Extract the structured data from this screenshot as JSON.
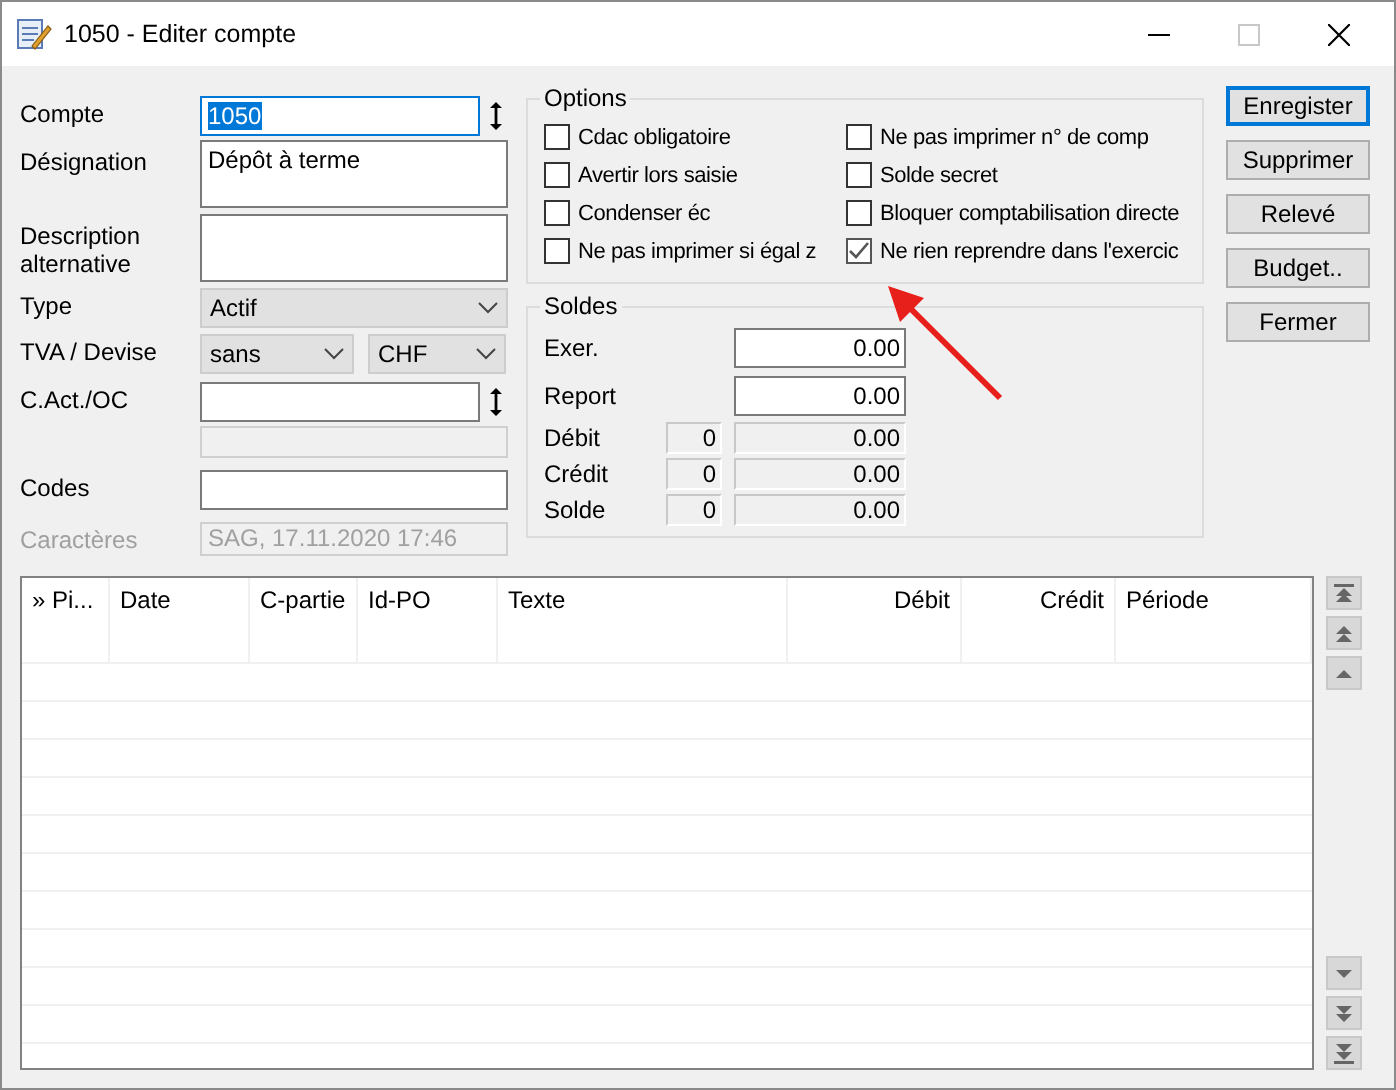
{
  "window": {
    "title": "1050 - Editer compte"
  },
  "fields": [
    {
      "kind": "spin",
      "label": "Compte",
      "value": "1050",
      "focused": true
    },
    {
      "kind": "memo",
      "label": "Désignation",
      "value": "Dépôt à terme",
      "focused": false
    },
    {
      "kind": "memo",
      "label": "Description alternative",
      "focused": false
    },
    {
      "kind": "combo",
      "label": "Type",
      "value": "Actif",
      "focused": false
    },
    {
      "kind": "combo-pair",
      "label": "TVA / Devise",
      "value": "sans",
      "value_2": "CHF",
      "focused": false
    },
    {
      "kind": "spin",
      "label": "C.Act./OC",
      "focused": false
    },
    {
      "kind": "blank",
      "focused": false
    },
    {
      "kind": "text",
      "label": "Codes",
      "focused": false
    },
    {
      "kind": "readonly",
      "label": "Caractères",
      "value": "SAG, 17.11.2020 17:46",
      "focused": false
    }
  ],
  "options": {
    "title": "Options",
    "items": [
      {
        "label": "Cdac obligatoire",
        "checked": false
      },
      {
        "label": "Avertir lors saisie",
        "checked": false
      },
      {
        "label": "Condenser éc",
        "checked": false
      },
      {
        "label": "Ne pas imprimer si égal z",
        "checked": false
      },
      {
        "label": "Ne pas imprimer n° de comp",
        "checked": false
      },
      {
        "label": "Solde secret",
        "checked": false
      },
      {
        "label": "Bloquer comptabilisation directe",
        "checked": false
      },
      {
        "label": "Ne rien reprendre dans l'exercic",
        "checked": true
      }
    ]
  },
  "soldes": {
    "title": "Soldes",
    "rows": [
      {
        "kind": "input",
        "label": "Exer.",
        "value": "0.00"
      },
      {
        "kind": "input",
        "label": "Report",
        "value": "0.00"
      },
      {
        "kind": "readonly",
        "label": "Débit",
        "count": "0",
        "value": "0.00"
      },
      {
        "kind": "readonly",
        "label": "Crédit",
        "count": "0",
        "value": "0.00"
      },
      {
        "kind": "readonly",
        "label": "Solde",
        "count": "0",
        "value": "0.00"
      }
    ]
  },
  "buttons": [
    {
      "label": "Enregister",
      "default": true
    },
    {
      "label": "Supprimer",
      "default": false
    },
    {
      "label": "Relevé",
      "default": false
    },
    {
      "label": "Budget..",
      "default": false
    },
    {
      "label": "Fermer",
      "default": false
    }
  ],
  "table": {
    "columns": [
      {
        "label": "» Pi...",
        "kind": "text"
      },
      {
        "label": "Date",
        "kind": "text"
      },
      {
        "label": "C-partie",
        "kind": "text"
      },
      {
        "label": "Id-PO",
        "kind": "text"
      },
      {
        "label": "Texte",
        "kind": "text"
      },
      {
        "label": "Débit",
        "kind": "amount"
      },
      {
        "label": "Crédit",
        "kind": "amount"
      },
      {
        "label": "Période",
        "kind": "text"
      }
    ]
  }
}
